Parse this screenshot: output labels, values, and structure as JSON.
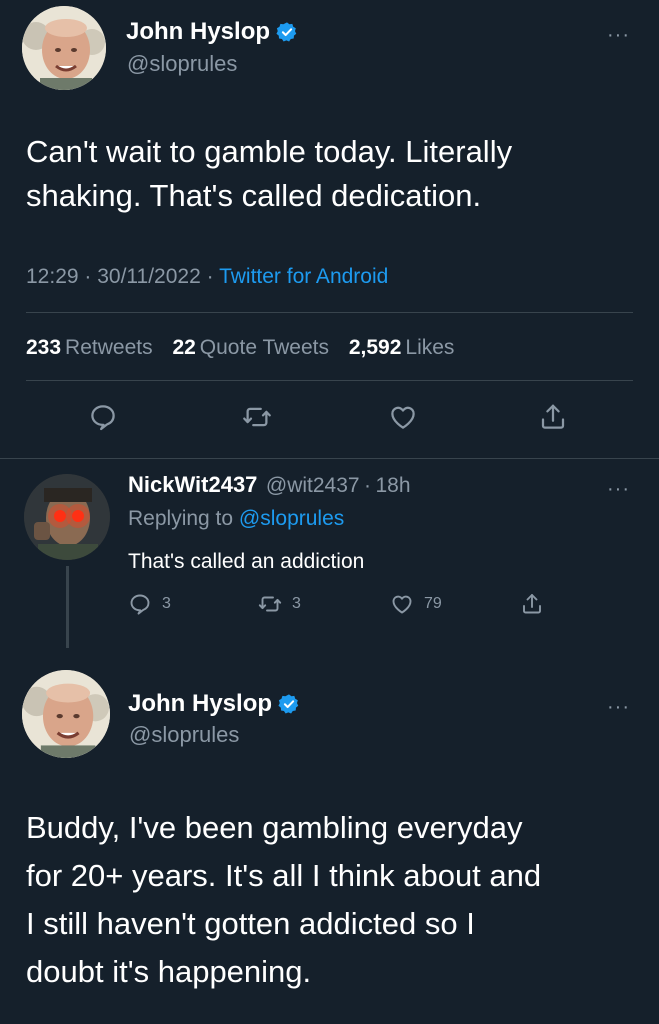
{
  "tweet1": {
    "author": {
      "name": "John Hyslop",
      "handle": "@sloprules"
    },
    "text": "Can't wait to gamble today. Literally shaking. That's called dedication.",
    "time": "12:29",
    "date": "30/11/2022",
    "source": "Twitter for Android",
    "stats": {
      "retweets_count": "233",
      "retweets_label": "Retweets",
      "quotes_count": "22",
      "quotes_label": "Quote Tweets",
      "likes_count": "2,592",
      "likes_label": "Likes"
    }
  },
  "reply": {
    "author": {
      "name": "NickWit2437",
      "handle": "@wit2437",
      "time": "18h"
    },
    "replying_prefix": "Replying to",
    "replying_to": "@sloprules",
    "text": "That's called an addiction",
    "counts": {
      "replies": "3",
      "retweets": "3",
      "likes": "79"
    }
  },
  "tweet2": {
    "author": {
      "name": "John Hyslop",
      "handle": "@sloprules"
    },
    "text_lines": [
      "Buddy, I've been gambling everyday",
      "for 20+ years. It's all I think about and",
      "I still haven't gotten addicted so I",
      "doubt it's happening."
    ]
  },
  "icons": {
    "verified": "verified-badge-icon",
    "reply": "reply-icon",
    "retweet": "retweet-icon",
    "like": "heart-icon",
    "share": "share-icon",
    "more": "more-icon"
  },
  "colors": {
    "background": "#15202b",
    "text": "#ffffff",
    "muted": "#8b98a5",
    "accent": "#1d9bf0",
    "divider": "#38444d"
  }
}
